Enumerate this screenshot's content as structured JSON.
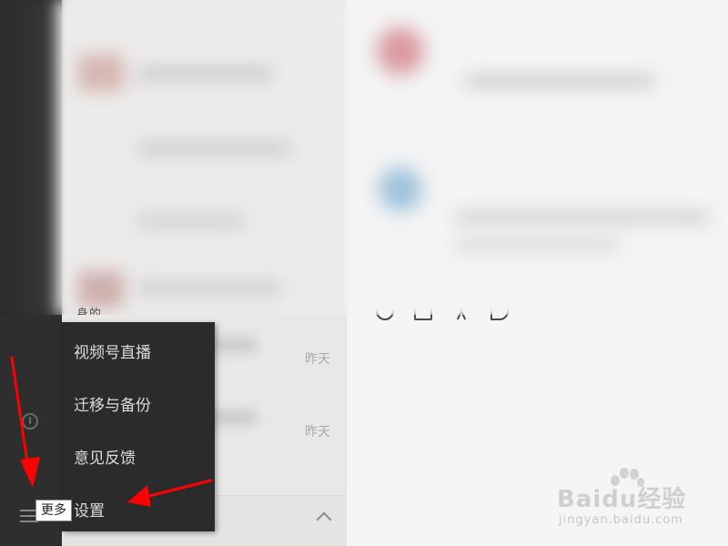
{
  "chat_list": {
    "times": [
      "昨天",
      "昨天"
    ],
    "partial_message": "身的。"
  },
  "more_menu": {
    "items": [
      {
        "label": "视频号直播"
      },
      {
        "label": "迁移与备份"
      },
      {
        "label": "意见反馈"
      },
      {
        "label": "设置"
      }
    ]
  },
  "sidebar": {
    "more_tooltip": "更多",
    "icons": [
      "music-icon",
      "menu-icon"
    ]
  },
  "toolbar": {
    "icons": [
      "emoji-icon",
      "folder-icon",
      "scissors-icon",
      "chat-history-icon"
    ]
  },
  "watermark": {
    "main": "Baidu经验",
    "sub": "jingyan.baidu.com"
  },
  "colors": {
    "sidebar_bg": "#2e2e2e",
    "menu_bg": "#2b2b2b",
    "arrow": "#ff0000"
  }
}
